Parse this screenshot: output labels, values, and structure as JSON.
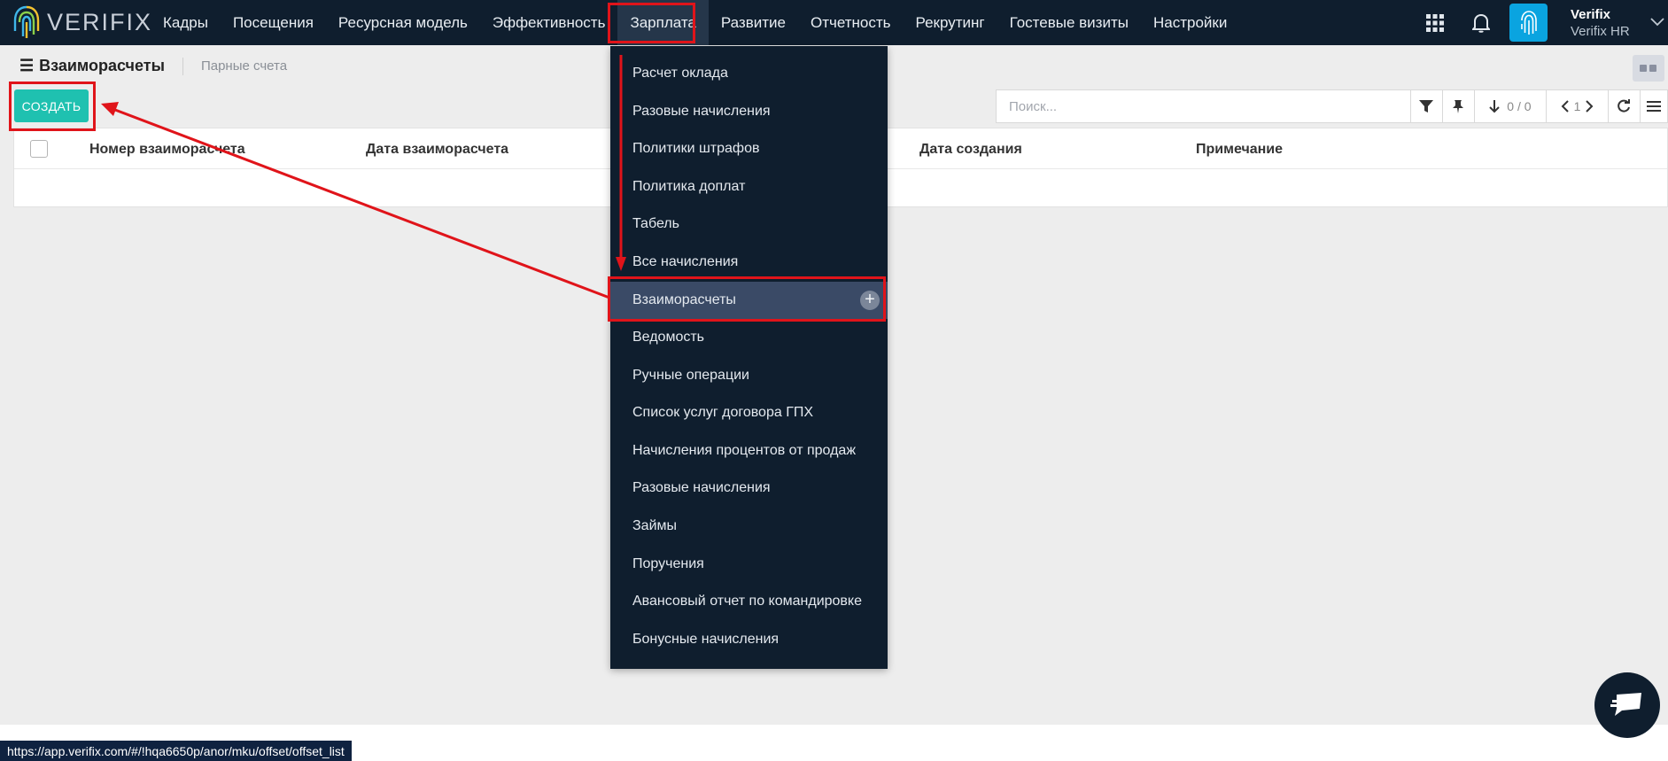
{
  "brand": {
    "name": "VERIFIX"
  },
  "nav": {
    "items": [
      {
        "label": "Кадры"
      },
      {
        "label": "Посещения"
      },
      {
        "label": "Ресурсная модель"
      },
      {
        "label": "Эффективность"
      },
      {
        "label": "Зарплата",
        "active": true
      },
      {
        "label": "Развитие"
      },
      {
        "label": "Отчетность"
      },
      {
        "label": "Рекрутинг"
      },
      {
        "label": "Гостевые визиты"
      },
      {
        "label": "Настройки"
      }
    ]
  },
  "user": {
    "name": "Verifix",
    "company": "Verifix HR"
  },
  "breadcrumb": {
    "title": "Взаиморасчеты",
    "link": "Парные счета"
  },
  "toolbar": {
    "create_label": "СОЗДАТЬ",
    "search_placeholder": "Поиск...",
    "pager": "0 / 0",
    "page": "1"
  },
  "table": {
    "headers": [
      "Номер взаиморасчета",
      "Дата взаиморасчета",
      "Дата создания",
      "Примечание"
    ]
  },
  "dropdown": {
    "items": [
      {
        "label": "Расчет оклада"
      },
      {
        "label": "Разовые начисления"
      },
      {
        "label": "Политики штрафов"
      },
      {
        "label": "Политика доплат"
      },
      {
        "label": "Табель"
      },
      {
        "label": "Все начисления"
      },
      {
        "label": "Взаиморасчеты",
        "selected": true
      },
      {
        "label": "Ведомость"
      },
      {
        "label": "Ручные операции"
      },
      {
        "label": "Список услуг договора ГПХ"
      },
      {
        "label": "Начисления процентов от продаж"
      },
      {
        "label": "Разовые начисления"
      },
      {
        "label": "Займы"
      },
      {
        "label": "Поручения"
      },
      {
        "label": "Авансовый отчет по командировке"
      },
      {
        "label": "Бонусные начисления"
      }
    ]
  },
  "status_url": "https://app.verifix.com/#/!hqa6650p/anor/mku/offset/offset_list",
  "colors": {
    "topbar": "#0f1e2e",
    "accent": "#1fc1b0",
    "annotation": "#e0141a",
    "selected": "#3a4a66"
  }
}
